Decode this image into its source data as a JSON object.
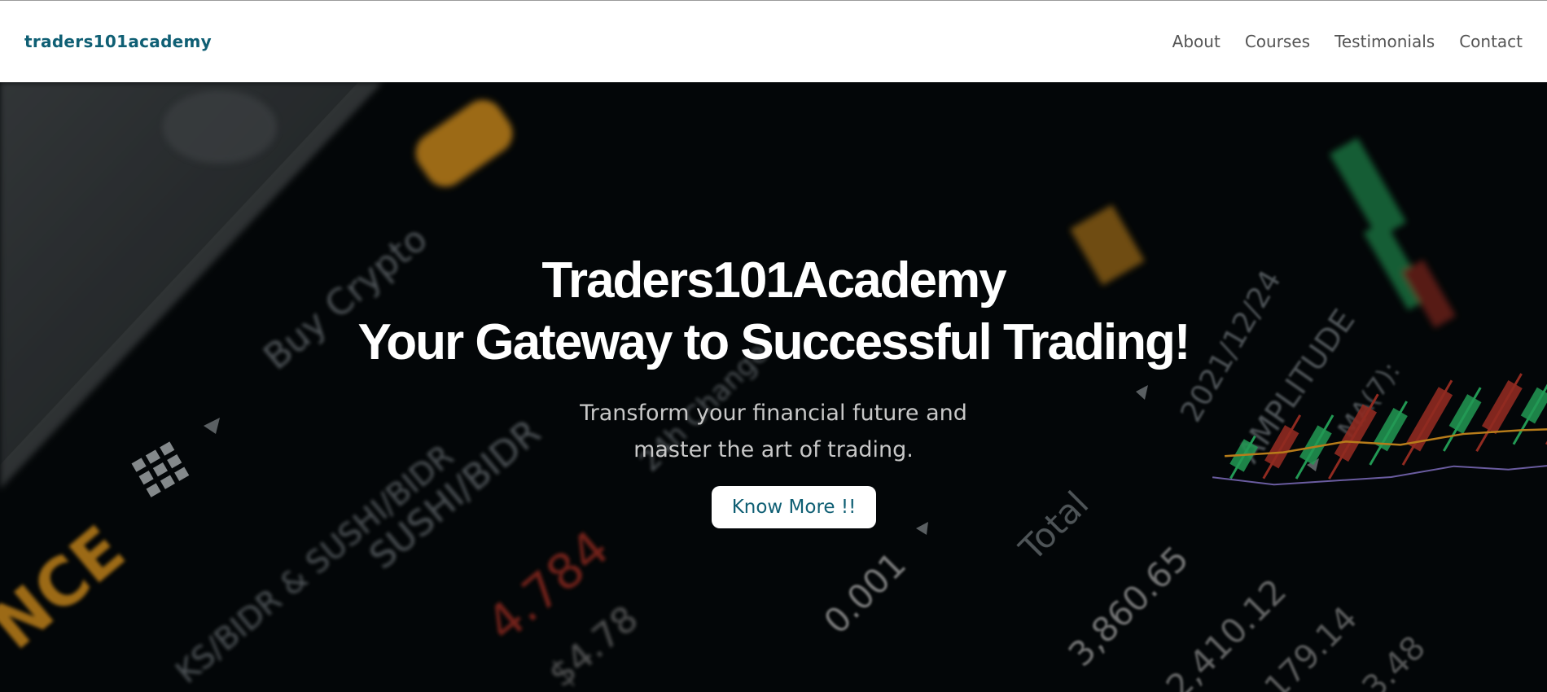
{
  "navbar": {
    "brand": "traders101academy",
    "links": [
      "About",
      "Courses",
      "Testimonials",
      "Contact"
    ]
  },
  "hero": {
    "title_line1": "Traders101Academy",
    "title_line2": "Your Gateway to Successful Trading!",
    "subtitle": "Transform your financial future and master the art of trading.",
    "button_label": "Know More !!",
    "background_texts": {
      "buy_crypto": "Buy Crypto",
      "pair": "SUSHI/BIDR",
      "pair2": "KS/BIDR & SUSHI/BIDR",
      "price_red": "4.784",
      "price_small": "$4.78",
      "amount": "0.001",
      "total_label": "Total",
      "value1": "3,860.65",
      "value2": "2,410.12",
      "value3": "179.14",
      "value4": "3.48",
      "date": "2021/12/24",
      "amplitude": "AMPLITUDE",
      "ma": "MA(7):",
      "change": "24h Change",
      "brand_partial": "NCE"
    }
  },
  "colors": {
    "brand": "#0f5f74",
    "hero_bg": "#05090b",
    "candle_red": "#c0392b",
    "candle_green": "#2ecc71",
    "accent_yellow": "#f5a623"
  }
}
